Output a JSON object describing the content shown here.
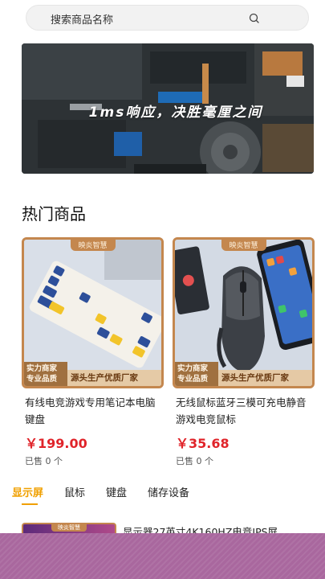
{
  "search": {
    "placeholder": "搜索商品名称",
    "icon": "search-icon"
  },
  "banner": {
    "text": "1ms响应，决胜毫厘之间",
    "dots": 2,
    "active_dot": 0
  },
  "section_title": "热门商品",
  "products": [
    {
      "brand": "映炎智慧",
      "badge_left": [
        "实力商家",
        "专业品质"
      ],
      "badge_right": "源头生产优质厂家",
      "title": "有线电竞游戏专用笔记本电脑键盘",
      "price": "￥199.00",
      "sold": "已售 0 个"
    },
    {
      "brand": "映炎智慧",
      "badge_left": [
        "实力商家",
        "专业品质"
      ],
      "badge_right": "源头生产优质厂家",
      "title": "无线鼠标蓝牙三模可充电静音游戏电竞鼠标",
      "price": "￥35.68",
      "sold": "已售 0 个"
    }
  ],
  "tabs": [
    {
      "label": "显示屏",
      "active": true
    },
    {
      "label": "鼠标",
      "active": false
    },
    {
      "label": "键盘",
      "active": false
    },
    {
      "label": "储存设备",
      "active": false
    }
  ],
  "list_items": [
    {
      "brand": "映炎智慧",
      "title": "显示器27英寸4K160HZ电竞IPS屏"
    }
  ],
  "colors": {
    "accent": "#f0a000",
    "price": "#e0242a",
    "card_border": "#c4874e",
    "overlay": "#a9679e"
  }
}
